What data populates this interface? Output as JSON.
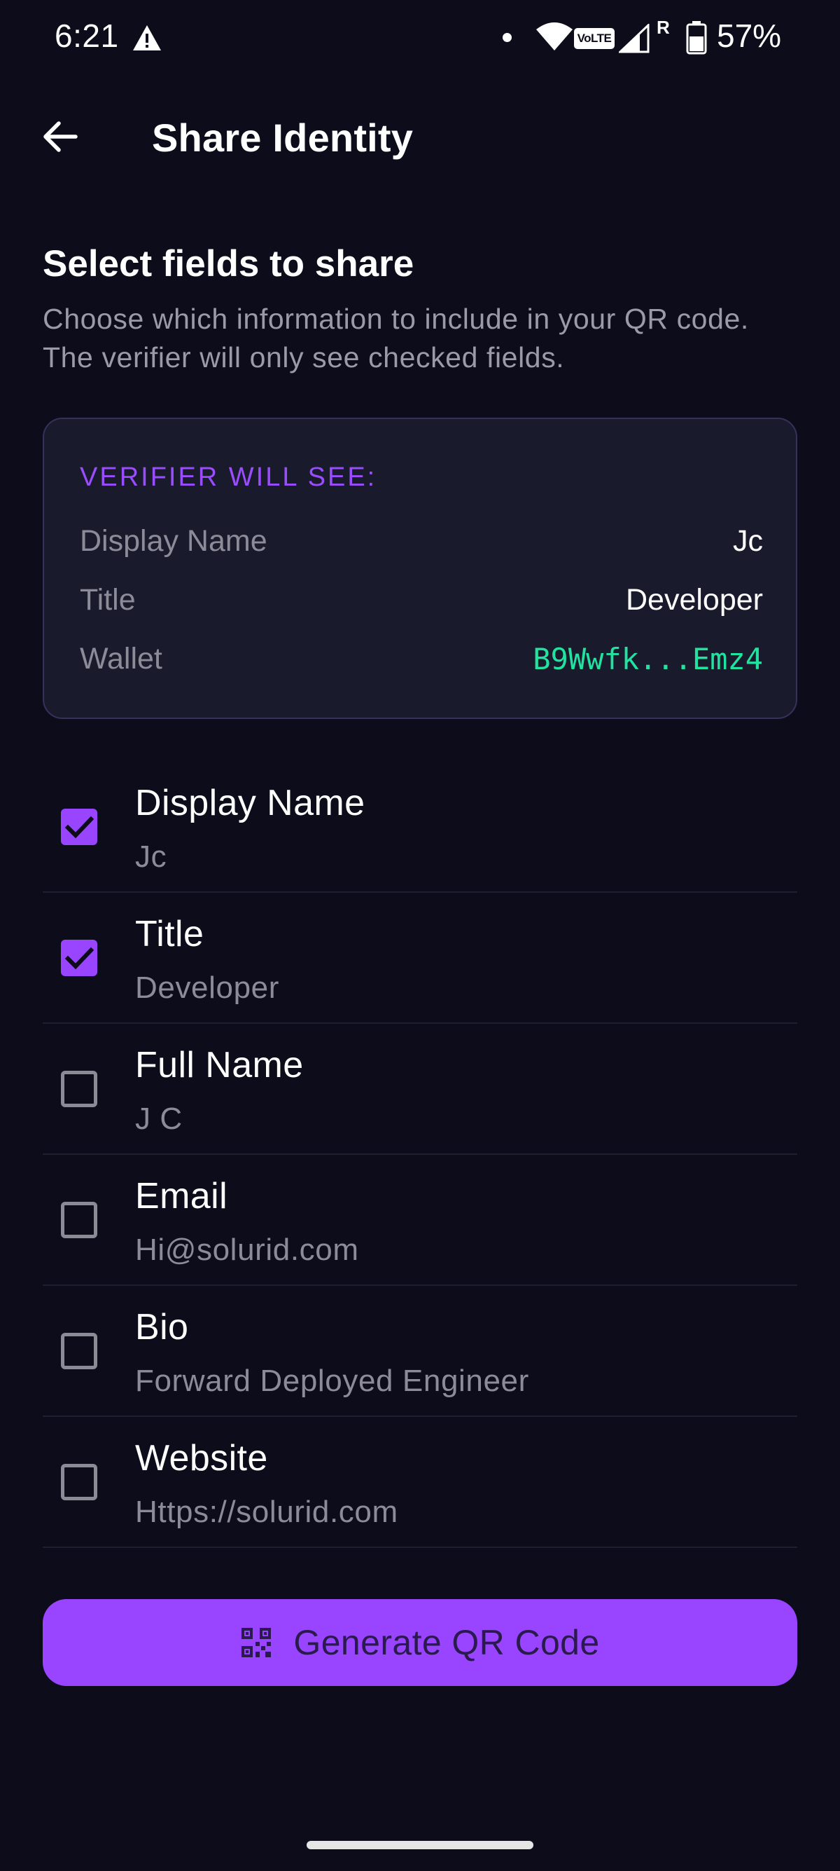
{
  "status_bar": {
    "time": "6:21",
    "network_type": "VoLTE",
    "roaming": "R",
    "battery_percent": "57%",
    "icons": [
      "alert-icon",
      "dot-icon",
      "wifi-icon",
      "volte-icon",
      "signal-icon",
      "battery-icon"
    ]
  },
  "app_bar": {
    "title": "Share Identity",
    "back_icon": "arrow-left-icon"
  },
  "intro": {
    "heading": "Select fields to share",
    "description": "Choose which information to include in your QR code. The verifier will only see checked fields."
  },
  "preview": {
    "label": "VERIFIER WILL SEE:",
    "rows": [
      {
        "key": "Display Name",
        "value": "Jc"
      },
      {
        "key": "Title",
        "value": "Developer"
      },
      {
        "key": "Wallet",
        "value": "B9Wwfk...Emz4"
      }
    ]
  },
  "fields": [
    {
      "label": "Display Name",
      "value": "Jc",
      "checked": true
    },
    {
      "label": "Title",
      "value": "Developer",
      "checked": true
    },
    {
      "label": "Full Name",
      "value": "J C",
      "checked": false
    },
    {
      "label": "Email",
      "value": "Hi@solurid.com",
      "checked": false
    },
    {
      "label": "Bio",
      "value": "Forward Deployed Engineer",
      "checked": false
    },
    {
      "label": "Website",
      "value": "Https://solurid.com",
      "checked": false
    }
  ],
  "generate_button": {
    "label": "Generate QR Code",
    "icon": "qr-code-icon"
  },
  "colors": {
    "background": "#0c0c1a",
    "accent": "#9945ff",
    "wallet": "#22e2a0",
    "card": "#1a1a2d"
  }
}
